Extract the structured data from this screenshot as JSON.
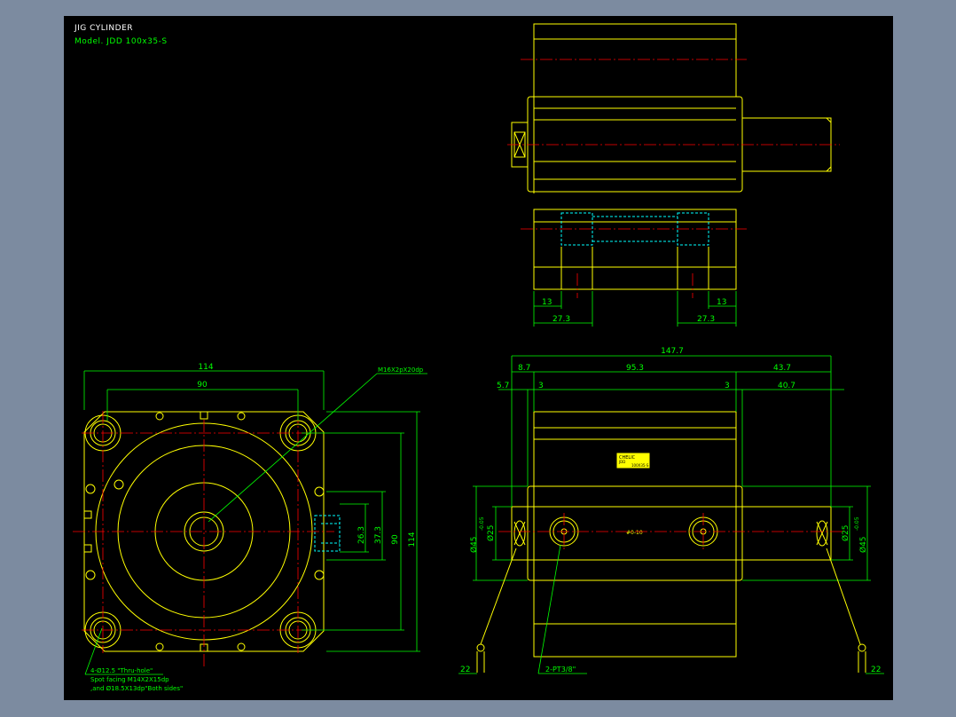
{
  "title": {
    "line1": "JIG CYLINDER",
    "line2": "Model. JDD 100x35-S"
  },
  "colors": {
    "background": "#000000",
    "outline": "#ffff00",
    "dimension": "#00ff00",
    "centerline": "#ff0000",
    "hidden": "#00ffff",
    "title": "#ffffff"
  },
  "side_view": {
    "dims": {
      "d13_left": "13",
      "d273_left": "27.3",
      "d273_right": "27.3",
      "d13_right": "13"
    }
  },
  "front_view": {
    "dims": {
      "w114": "114",
      "w90": "90",
      "h114": "114",
      "h90": "90",
      "h373": "37.3",
      "h263": "26.3"
    },
    "callout_thread": "M16X2pX20dp",
    "note_lines": [
      "4-Ø12.5 \"Thru-hole\"",
      "Spot facing  M14X2X15dp",
      ",and Ø18.5X13dp\"Both sides\""
    ]
  },
  "bottom_view": {
    "dims": {
      "overall": "147.7",
      "left": "8.7",
      "middle": "95.3",
      "right": "43.7",
      "d57": "5.7",
      "d3_left": "3",
      "d3_right": "3",
      "d407": "40.7",
      "d25_left": "Ø25",
      "d45_left": "Ø45",
      "d45_left_tol": "-0.05",
      "d25_right": "Ø25",
      "d45_right": "Ø45",
      "d45_right_tol": "-0.05",
      "d22_left": "22",
      "d22_right": "22",
      "port_note": "2-PT3/8\"",
      "center_mark": "#0-10"
    },
    "label": {
      "brand": "CHELIC",
      "line2": "JDD",
      "line3": "100X35-S"
    }
  }
}
